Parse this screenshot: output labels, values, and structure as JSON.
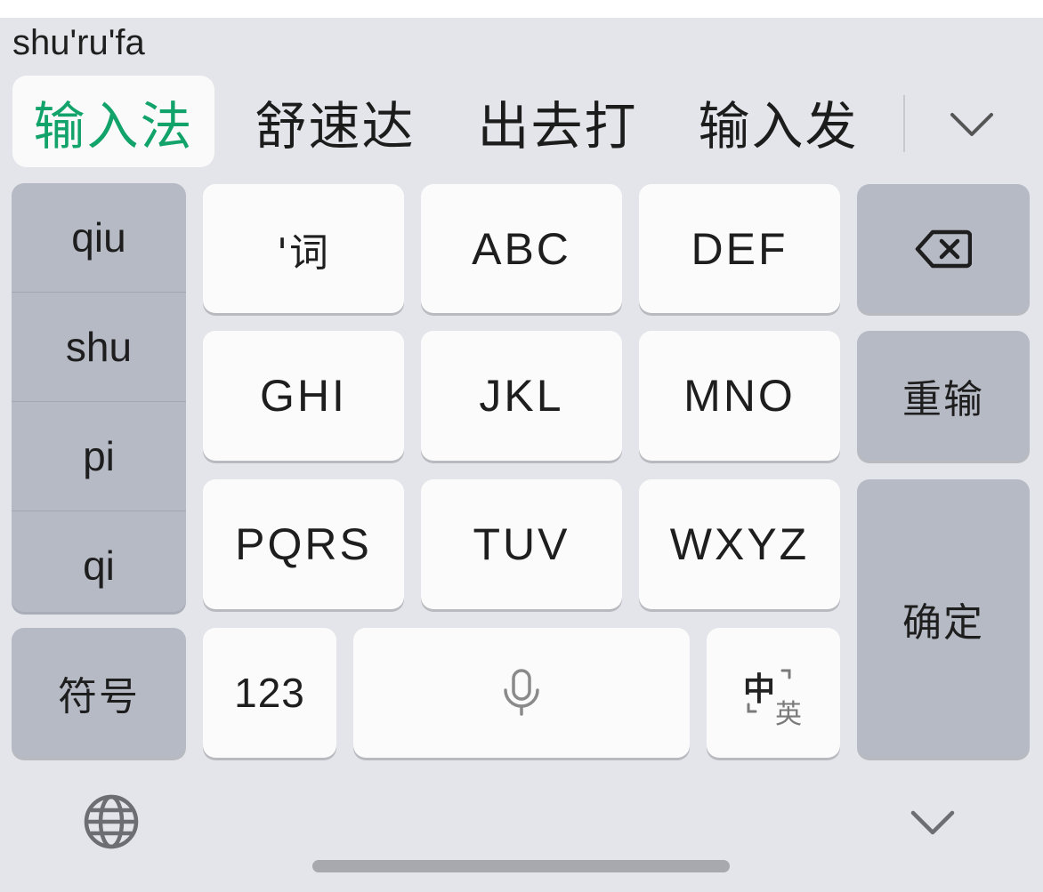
{
  "composing_text": "shu'ru'fa",
  "candidates": [
    "输入法",
    "舒速达",
    "出去打",
    "输入发"
  ],
  "selected_candidate_index": 0,
  "pinyin_options": [
    "qiu",
    "shu",
    "pi",
    "qi"
  ],
  "keys": {
    "apostrophe_word": "'词",
    "abc": "ABC",
    "def": "DEF",
    "ghi": "GHI",
    "jkl": "JKL",
    "mno": "MNO",
    "pqrs": "PQRS",
    "tuv": "TUV",
    "wxyz": "WXYZ",
    "retype": "重输",
    "confirm": "确定",
    "symbols": "符号",
    "numbers": "123"
  },
  "lang_switch": {
    "primary": "中",
    "secondary": "英"
  },
  "icons": {
    "backspace": "backspace-icon",
    "microphone": "microphone-icon",
    "globe": "globe-icon",
    "collapse": "chevron-down-icon",
    "expand_candidates": "chevron-down-icon"
  },
  "colors": {
    "selected_candidate": "#11a36a",
    "keyboard_bg": "#e4e5ea",
    "function_key": "#b6bac5",
    "letter_key": "#fbfbfb"
  }
}
